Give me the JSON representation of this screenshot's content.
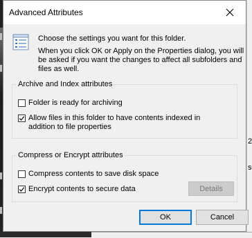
{
  "dialog": {
    "title": "Advanced Attributes",
    "intro_line1": "Choose the settings you want for this folder.",
    "intro_line2": "When you click OK or Apply on the Properties dialog, you will be asked if you want the changes to affect all subfolders and files as well."
  },
  "archive_group": {
    "title": "Archive and Index attributes",
    "folder_ready_label": "Folder is ready for archiving",
    "folder_ready_checked": false,
    "allow_index_label": "Allow files in this folder to have contents indexed in addition to file properties",
    "allow_index_checked": true
  },
  "compress_group": {
    "title": "Compress or Encrypt attributes",
    "compress_label": "Compress contents to save disk space",
    "compress_checked": false,
    "encrypt_label": "Encrypt contents to secure data",
    "encrypt_checked": true,
    "details_label": "Details"
  },
  "buttons": {
    "ok_label": "OK",
    "cancel_label": "Cancel"
  },
  "background_window": {
    "right_char_1": "2",
    "right_char_2": "s"
  },
  "colors": {
    "accent": "#0078d7",
    "dialog_bg": "#f0f0f0"
  }
}
